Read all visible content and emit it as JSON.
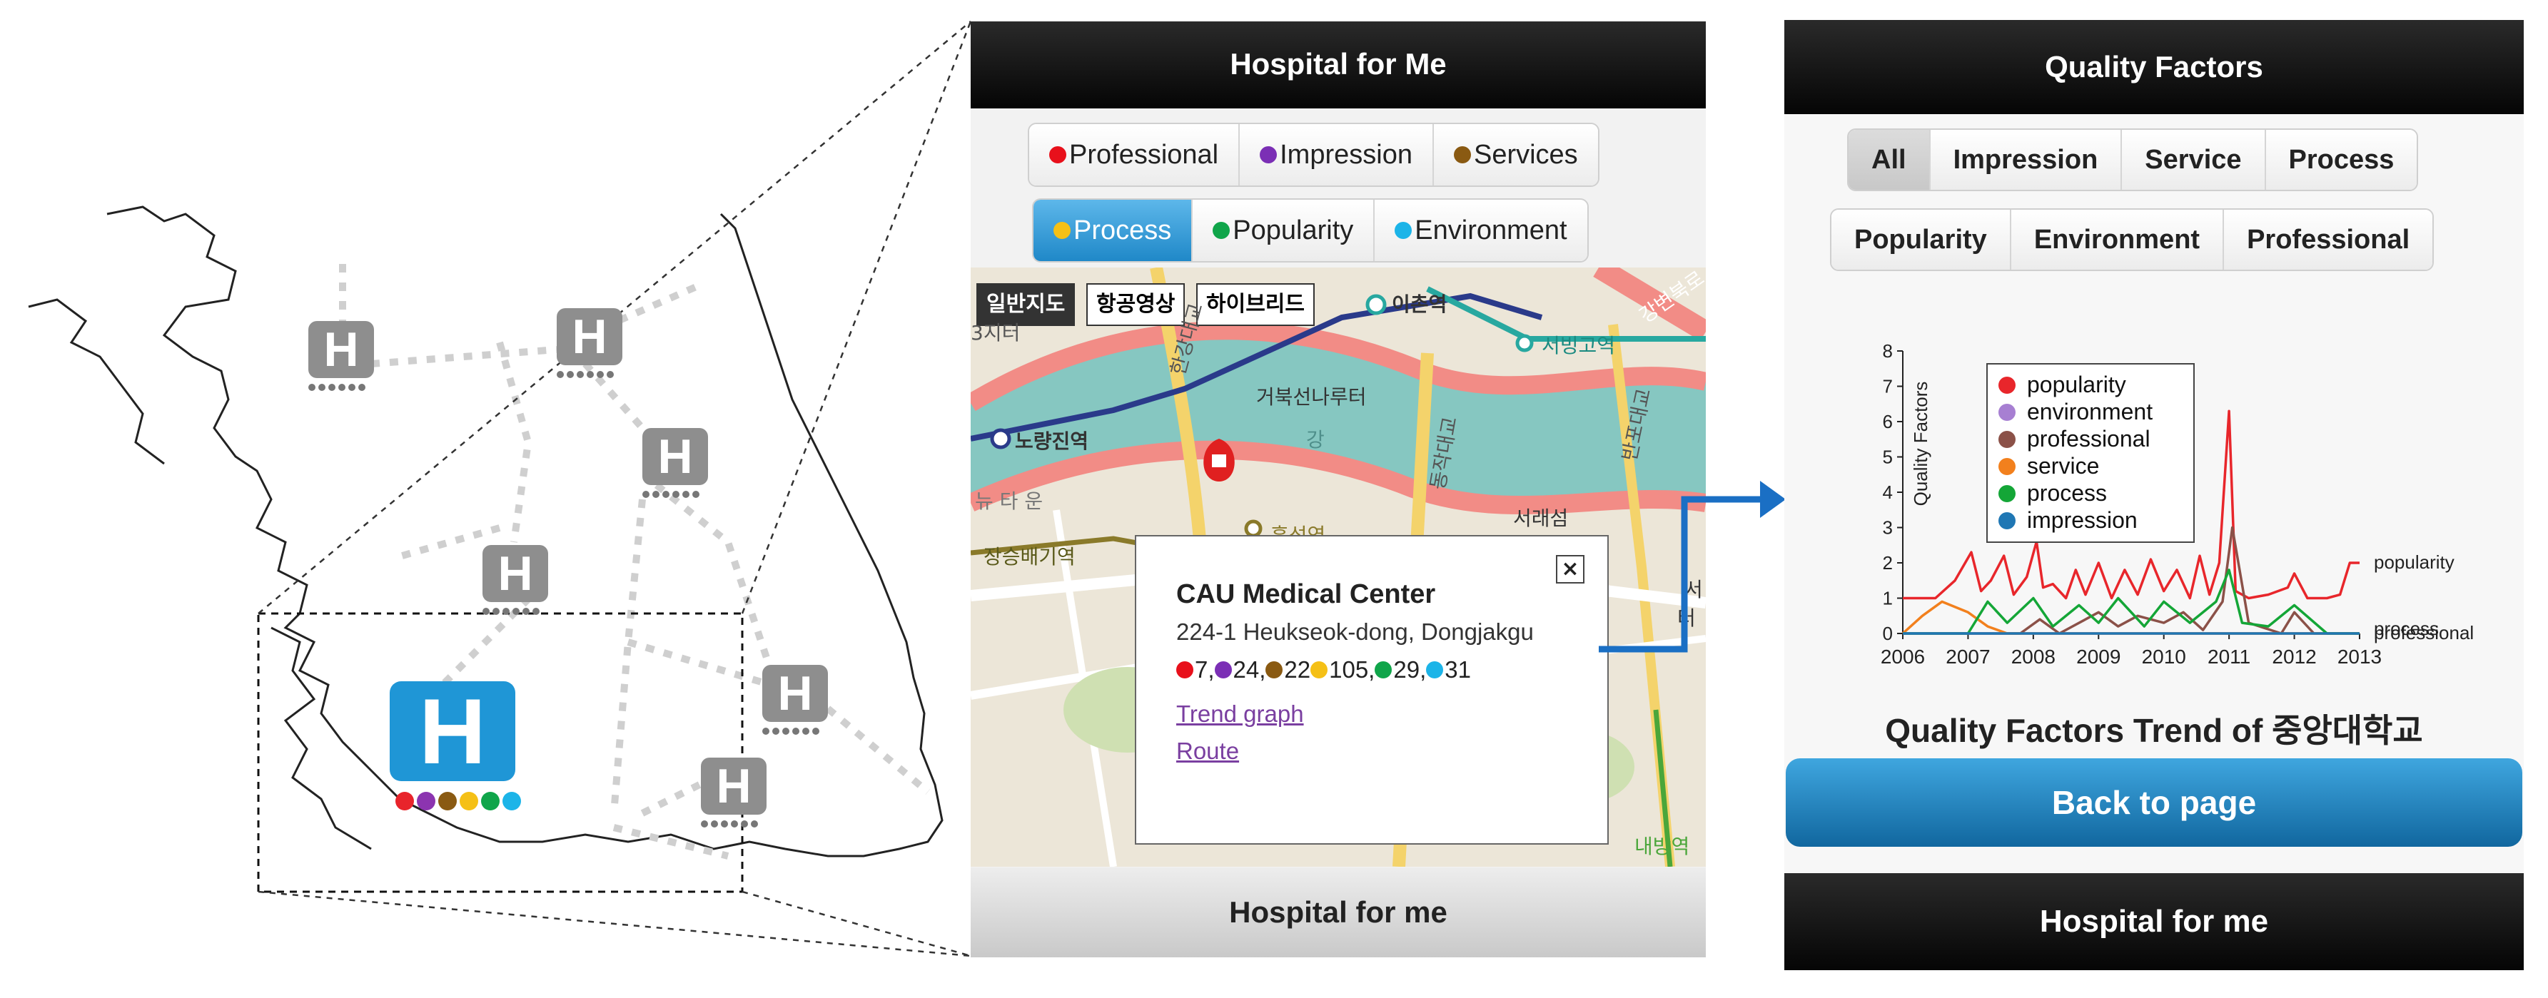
{
  "overview": {
    "marker_letter": "H",
    "category_colors": [
      "#e8242b",
      "#8c34b0",
      "#8a5a12",
      "#f5c016",
      "#10a54a",
      "#1cb4e8"
    ]
  },
  "screen1": {
    "header_title": "Hospital for Me",
    "filter_row1": [
      {
        "label": "Professional",
        "color": "#e8101b"
      },
      {
        "label": "Impression",
        "color": "#7b2fb5"
      },
      {
        "label": "Services",
        "color": "#8a5a12"
      }
    ],
    "filter_row2": [
      {
        "label": "Process",
        "color": "#f5c016",
        "active": true
      },
      {
        "label": "Popularity",
        "color": "#10a54a"
      },
      {
        "label": "Environment",
        "color": "#1cb4e8"
      }
    ],
    "map": {
      "tabs": [
        "일반지도",
        "항공영상",
        "하이브리드"
      ],
      "labels": {
        "ichon": "이촌역",
        "seobinggo": "서빙고역",
        "noryangjin": "노량진역",
        "geobukseon": "거북선나루터",
        "river": "강",
        "heukseok": "흑석역",
        "seoraeseom": "서래섬",
        "jangseungbaegi": "장승배기역",
        "hangangdaegyo": "한강대교",
        "dongjakdaegyo": "동작대교",
        "banpodaegyo": "반포대교",
        "gangbyeon": "강변북로",
        "newtown": "뉴 타 운",
        "jichi": "3지터",
        "sinbangyeok": "내방역",
        "seo": "서",
        "teo": "터"
      }
    },
    "popup": {
      "name": "CAU Medical Center",
      "address": "224-1 Heukseok-dong, Dongjakgu",
      "scores": [
        {
          "value": "7,",
          "color": "#e8101b"
        },
        {
          "value": "24,",
          "color": "#7b2fb5"
        },
        {
          "value": "22",
          "color": "#8a5a12"
        },
        {
          "value": "105,",
          "color": "#f5c016"
        },
        {
          "value": "29,",
          "color": "#10a54a"
        },
        {
          "value": "31",
          "color": "#1cb4e8"
        }
      ],
      "link_trend": "Trend graph",
      "link_route": "Route",
      "close_label": "×"
    },
    "footer_title": "Hospital for me"
  },
  "screen2": {
    "header_title": "Quality Factors",
    "tabs_row1": [
      "All",
      "Impression",
      "Service",
      "Process"
    ],
    "tabs_row2": [
      "Popularity",
      "Environment",
      "Professional"
    ],
    "selected_tab": "All",
    "chart_caption": "Quality Factors Trend of 중앙대학교",
    "back_button": "Back to page",
    "footer_title": "Hospital for me"
  },
  "chart_data": {
    "type": "line",
    "ylabel": "Quality Factors",
    "x_ticks": [
      2006,
      2007,
      2008,
      2009,
      2010,
      2011,
      2012,
      2013
    ],
    "xlim": [
      2006,
      2013
    ],
    "ylim": [
      0,
      8
    ],
    "y_ticks": [
      0,
      1,
      2,
      3,
      4,
      5,
      6,
      7,
      8
    ],
    "legend_position": "top-left",
    "legend": [
      "popularity",
      "environment",
      "professional",
      "service",
      "process",
      "impression"
    ],
    "series": [
      {
        "name": "popularity",
        "color": "#e8262b",
        "x": [
          2006.0,
          2006.5,
          2006.8,
          2007.05,
          2007.2,
          2007.35,
          2007.55,
          2007.7,
          2007.9,
          2008.05,
          2008.15,
          2008.3,
          2008.5,
          2008.65,
          2008.8,
          2009.0,
          2009.2,
          2009.4,
          2009.6,
          2009.8,
          2010.0,
          2010.2,
          2010.4,
          2010.55,
          2010.7,
          2010.85,
          2011.0,
          2011.1,
          2011.3,
          2011.6,
          2011.9,
          2012.0,
          2012.2,
          2012.5,
          2012.7,
          2012.85,
          2013.0
        ],
        "y": [
          1,
          1,
          1.5,
          2.3,
          1.2,
          1.5,
          2.2,
          1.1,
          1.6,
          2.6,
          1.3,
          1.4,
          1.0,
          1.8,
          1.1,
          2.0,
          1.0,
          1.8,
          1.1,
          2.1,
          1.2,
          1.8,
          1.0,
          2.2,
          1.1,
          2.0,
          6.3,
          1.2,
          1.0,
          1.1,
          1.3,
          1.7,
          1.0,
          1.0,
          1.1,
          2.0,
          2.0
        ]
      },
      {
        "name": "environment",
        "color": "#a77fd2",
        "x": [
          2006.0,
          2013.0
        ],
        "y": [
          0,
          0
        ]
      },
      {
        "name": "professional",
        "color": "#8b5148",
        "x": [
          2006.0,
          2007.8,
          2008.1,
          2008.4,
          2009.0,
          2009.3,
          2009.6,
          2010.0,
          2010.3,
          2010.6,
          2010.9,
          2011.05,
          2011.3,
          2011.8,
          2012.0,
          2012.3,
          2012.6,
          2013.0
        ],
        "y": [
          0,
          0,
          0.4,
          0,
          0.6,
          0.2,
          0.5,
          0.3,
          0.6,
          0.1,
          0.9,
          3.0,
          0.3,
          0.0,
          0.6,
          0.0,
          0.0,
          0.0
        ]
      },
      {
        "name": "service",
        "color": "#f2801d",
        "x": [
          2006.0,
          2006.3,
          2006.6,
          2007.0,
          2007.3,
          2007.6,
          2013.0
        ],
        "y": [
          0,
          0.5,
          0.9,
          0.6,
          0.2,
          0,
          0
        ]
      },
      {
        "name": "process",
        "color": "#14a637",
        "x": [
          2006.0,
          2007.0,
          2007.3,
          2007.6,
          2008.0,
          2008.3,
          2008.7,
          2009.0,
          2009.3,
          2009.7,
          2010.0,
          2010.4,
          2010.8,
          2011.0,
          2011.2,
          2011.6,
          2012.0,
          2012.5,
          2013.0
        ],
        "y": [
          0,
          0,
          0.9,
          0.3,
          1.0,
          0.2,
          0.8,
          0.3,
          1.0,
          0.2,
          0.9,
          0.3,
          0.9,
          1.8,
          0.3,
          0.2,
          0.8,
          0.0,
          0.0
        ]
      },
      {
        "name": "impression",
        "color": "#1f77b4",
        "x": [
          2006.0,
          2013.0
        ],
        "y": [
          0,
          0
        ]
      }
    ],
    "end_labels": [
      "popularity",
      "process",
      "professional"
    ]
  }
}
